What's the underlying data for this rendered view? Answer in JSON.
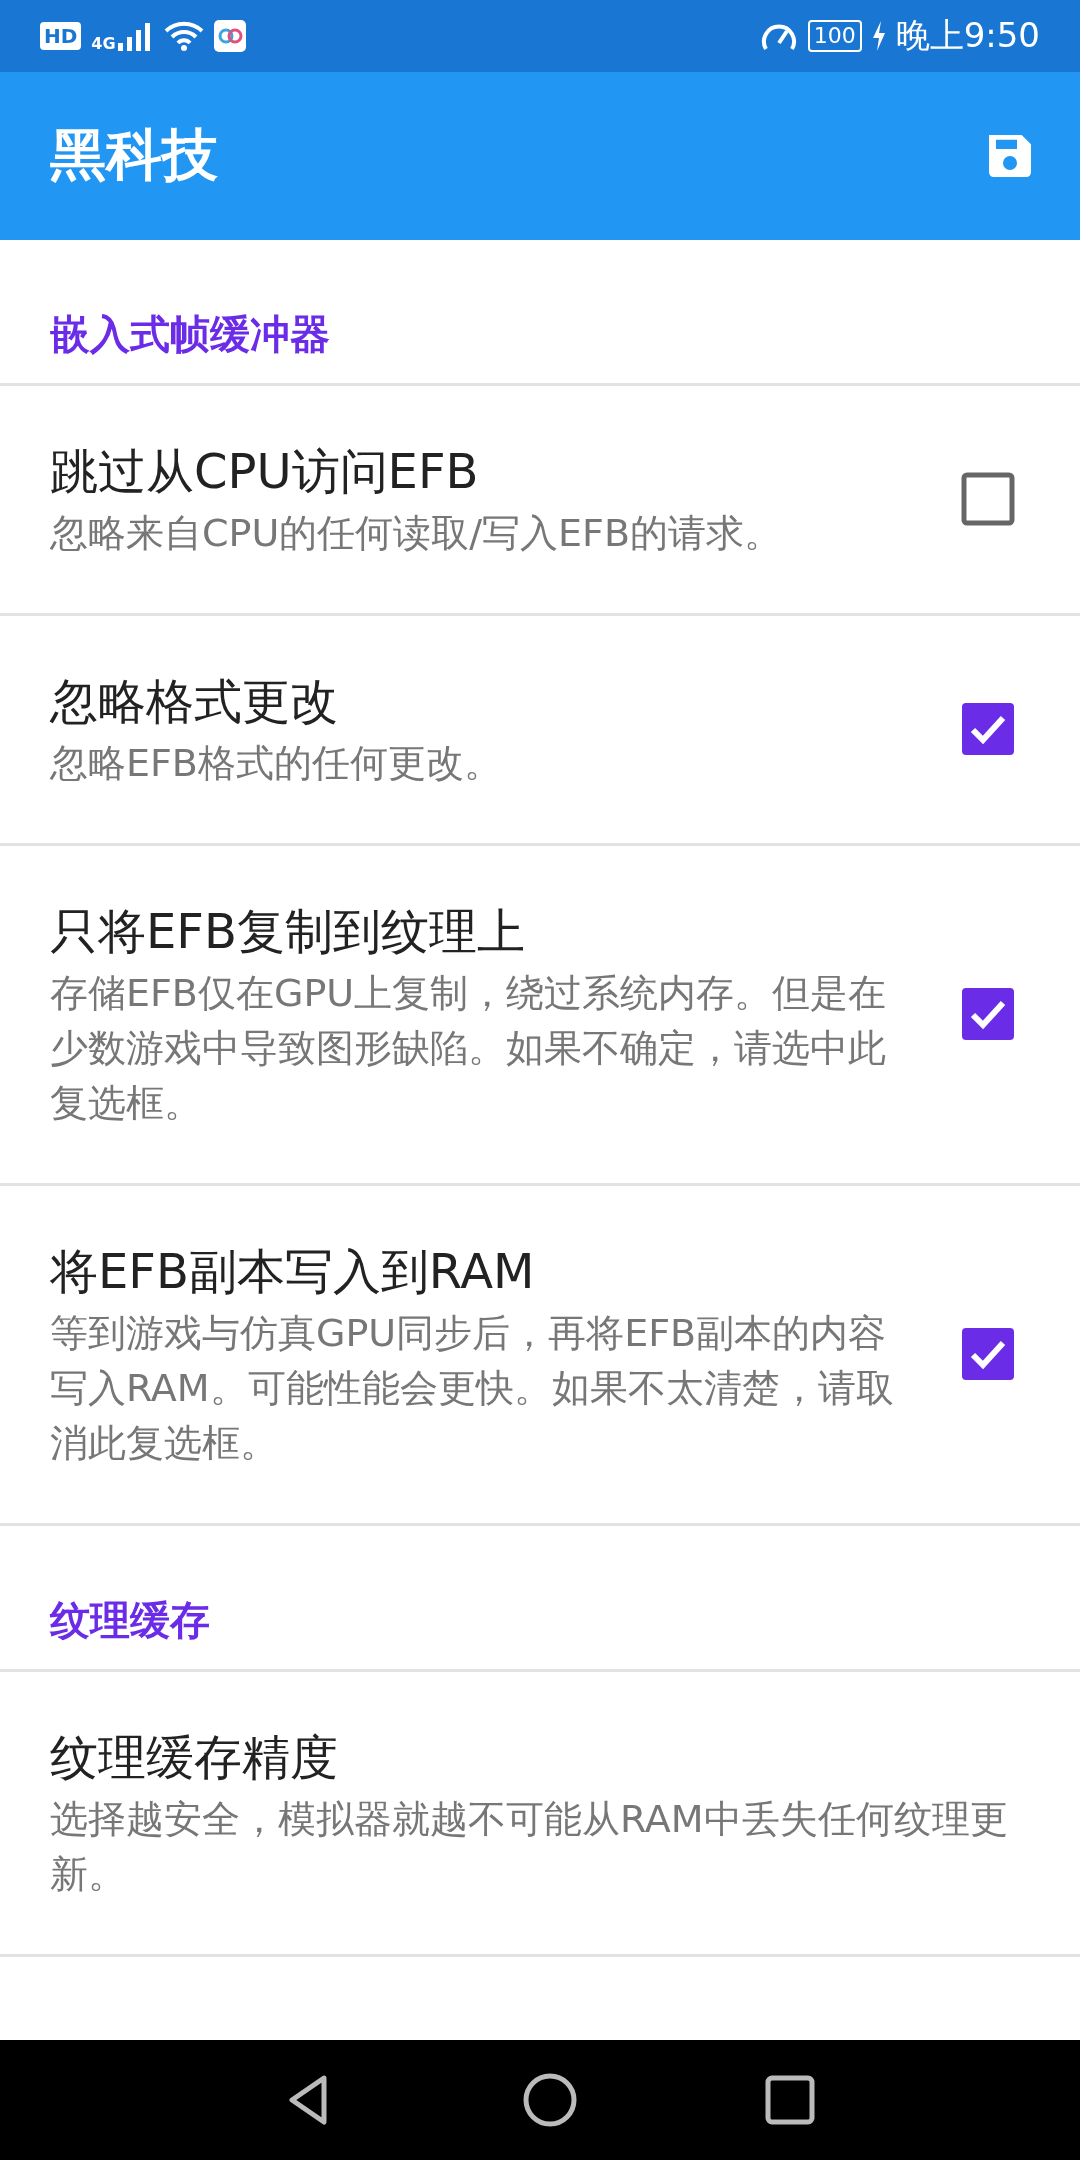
{
  "status_bar": {
    "badge": "HD",
    "network": "4G",
    "battery": "100",
    "time": "晚上9:50"
  },
  "app_bar": {
    "title": "黑科技"
  },
  "sections": [
    {
      "header": "嵌入式帧缓冲器",
      "items": [
        {
          "kind": "checkbox",
          "title": "跳过从CPU访问EFB",
          "summary": "忽略来自CPU的任何读取/写入EFB的请求。",
          "checked": false
        },
        {
          "kind": "checkbox",
          "title": "忽略格式更改",
          "summary": "忽略EFB格式的任何更改。",
          "checked": true
        },
        {
          "kind": "checkbox",
          "title": "只将EFB复制到纹理上",
          "summary": "存储EFB仅在GPU上复制，绕过系统内存。但是在少数游戏中导致图形缺陷。如果不确定，请选中此复选框。",
          "checked": true
        },
        {
          "kind": "checkbox",
          "title": "将EFB副本写入到RAM",
          "summary": "等到游戏与仿真GPU同步后，再将EFB副本的内容写入RAM。可能性能会更快。如果不太清楚，请取消此复选框。",
          "checked": true
        }
      ]
    },
    {
      "header": "纹理缓存",
      "items": [
        {
          "kind": "plain",
          "title": "纹理缓存精度",
          "summary": "选择越安全，模拟器就越不可能从RAM中丢失任何纹理更新。"
        }
      ]
    }
  ]
}
